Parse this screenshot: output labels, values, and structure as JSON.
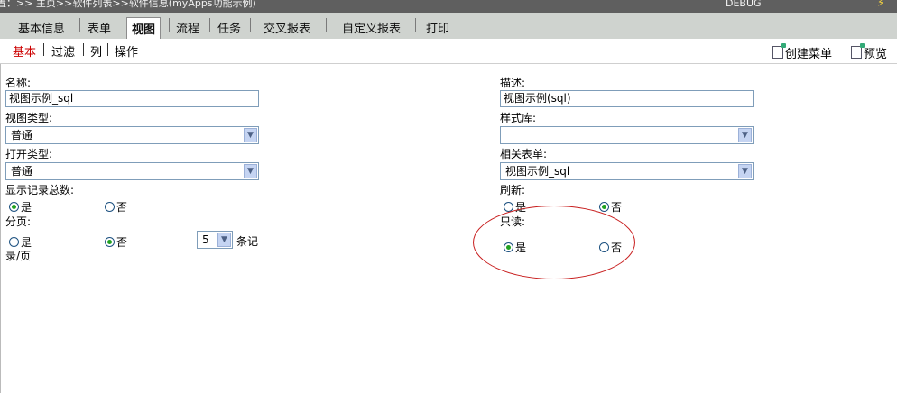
{
  "topbar": {
    "breadcrumb": "置：>> 主页>>软件列表>>软件信息(myApps功能示例)",
    "debug_label": "DEBUG"
  },
  "tabs": [
    "基本信息",
    "表单",
    "视图",
    "流程",
    "任务",
    "交叉报表",
    "自定义报表",
    "打印"
  ],
  "subnav": {
    "items": [
      "基本",
      "过滤",
      "列",
      "操作"
    ],
    "create_menu": "创建菜单",
    "preview": "预览"
  },
  "form": {
    "name_label": "名称:",
    "name_value": "视图示例_sql",
    "desc_label": "描述:",
    "desc_value": "视图示例(sql)",
    "view_type_label": "视图类型:",
    "view_type_value": "普通",
    "style_label": "样式库:",
    "style_value": "",
    "open_type_label": "打开类型:",
    "open_type_value": "普通",
    "related_form_label": "相关表单:",
    "related_form_value": "视图示例_sql",
    "show_total_label": "显示记录总数:",
    "refresh_label": "刷新:",
    "paging_label": "分页:",
    "readonly_label": "只读:",
    "yes": "是",
    "no": "否",
    "page_size": "5",
    "page_unit_a": "条记",
    "page_unit_b": "录/页"
  },
  "colors": {
    "annotation": "#c81e1e",
    "active_sub": "#cc0000",
    "tab_bar": "#cfd3cf"
  }
}
